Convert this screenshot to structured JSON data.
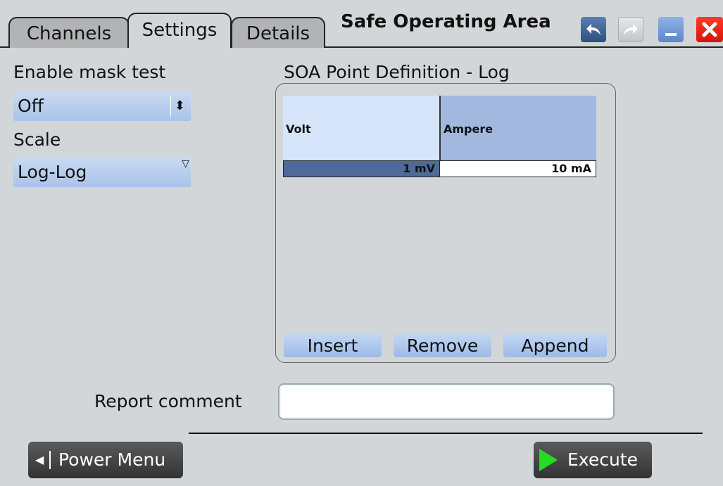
{
  "tabs": [
    {
      "label": "Channels"
    },
    {
      "label": "Settings"
    },
    {
      "label": "Details"
    }
  ],
  "window": {
    "title": "Safe Operating Area",
    "buttons": [
      "undo-icon",
      "redo-icon",
      "minimize-icon",
      "close-icon"
    ]
  },
  "settings": {
    "mask_test_label": "Enable mask test",
    "mask_test_value": "Off",
    "scale_label": "Scale",
    "scale_value": "Log-Log"
  },
  "soa": {
    "title": "SOA Point Definition - Log",
    "columns": [
      "Volt",
      "Ampere"
    ],
    "rows": [
      [
        "1 mV",
        "10 mA"
      ]
    ],
    "buttons": {
      "insert": "Insert",
      "remove": "Remove",
      "append": "Append"
    }
  },
  "report": {
    "label": "Report comment",
    "value": ""
  },
  "footer": {
    "power_menu": "Power Menu",
    "execute": "Execute"
  },
  "colors": {
    "background": "#d3d6d8",
    "dropdown": "#b9cfee",
    "execute_arrow": "#22dd22",
    "close_button": "#e8160c"
  }
}
